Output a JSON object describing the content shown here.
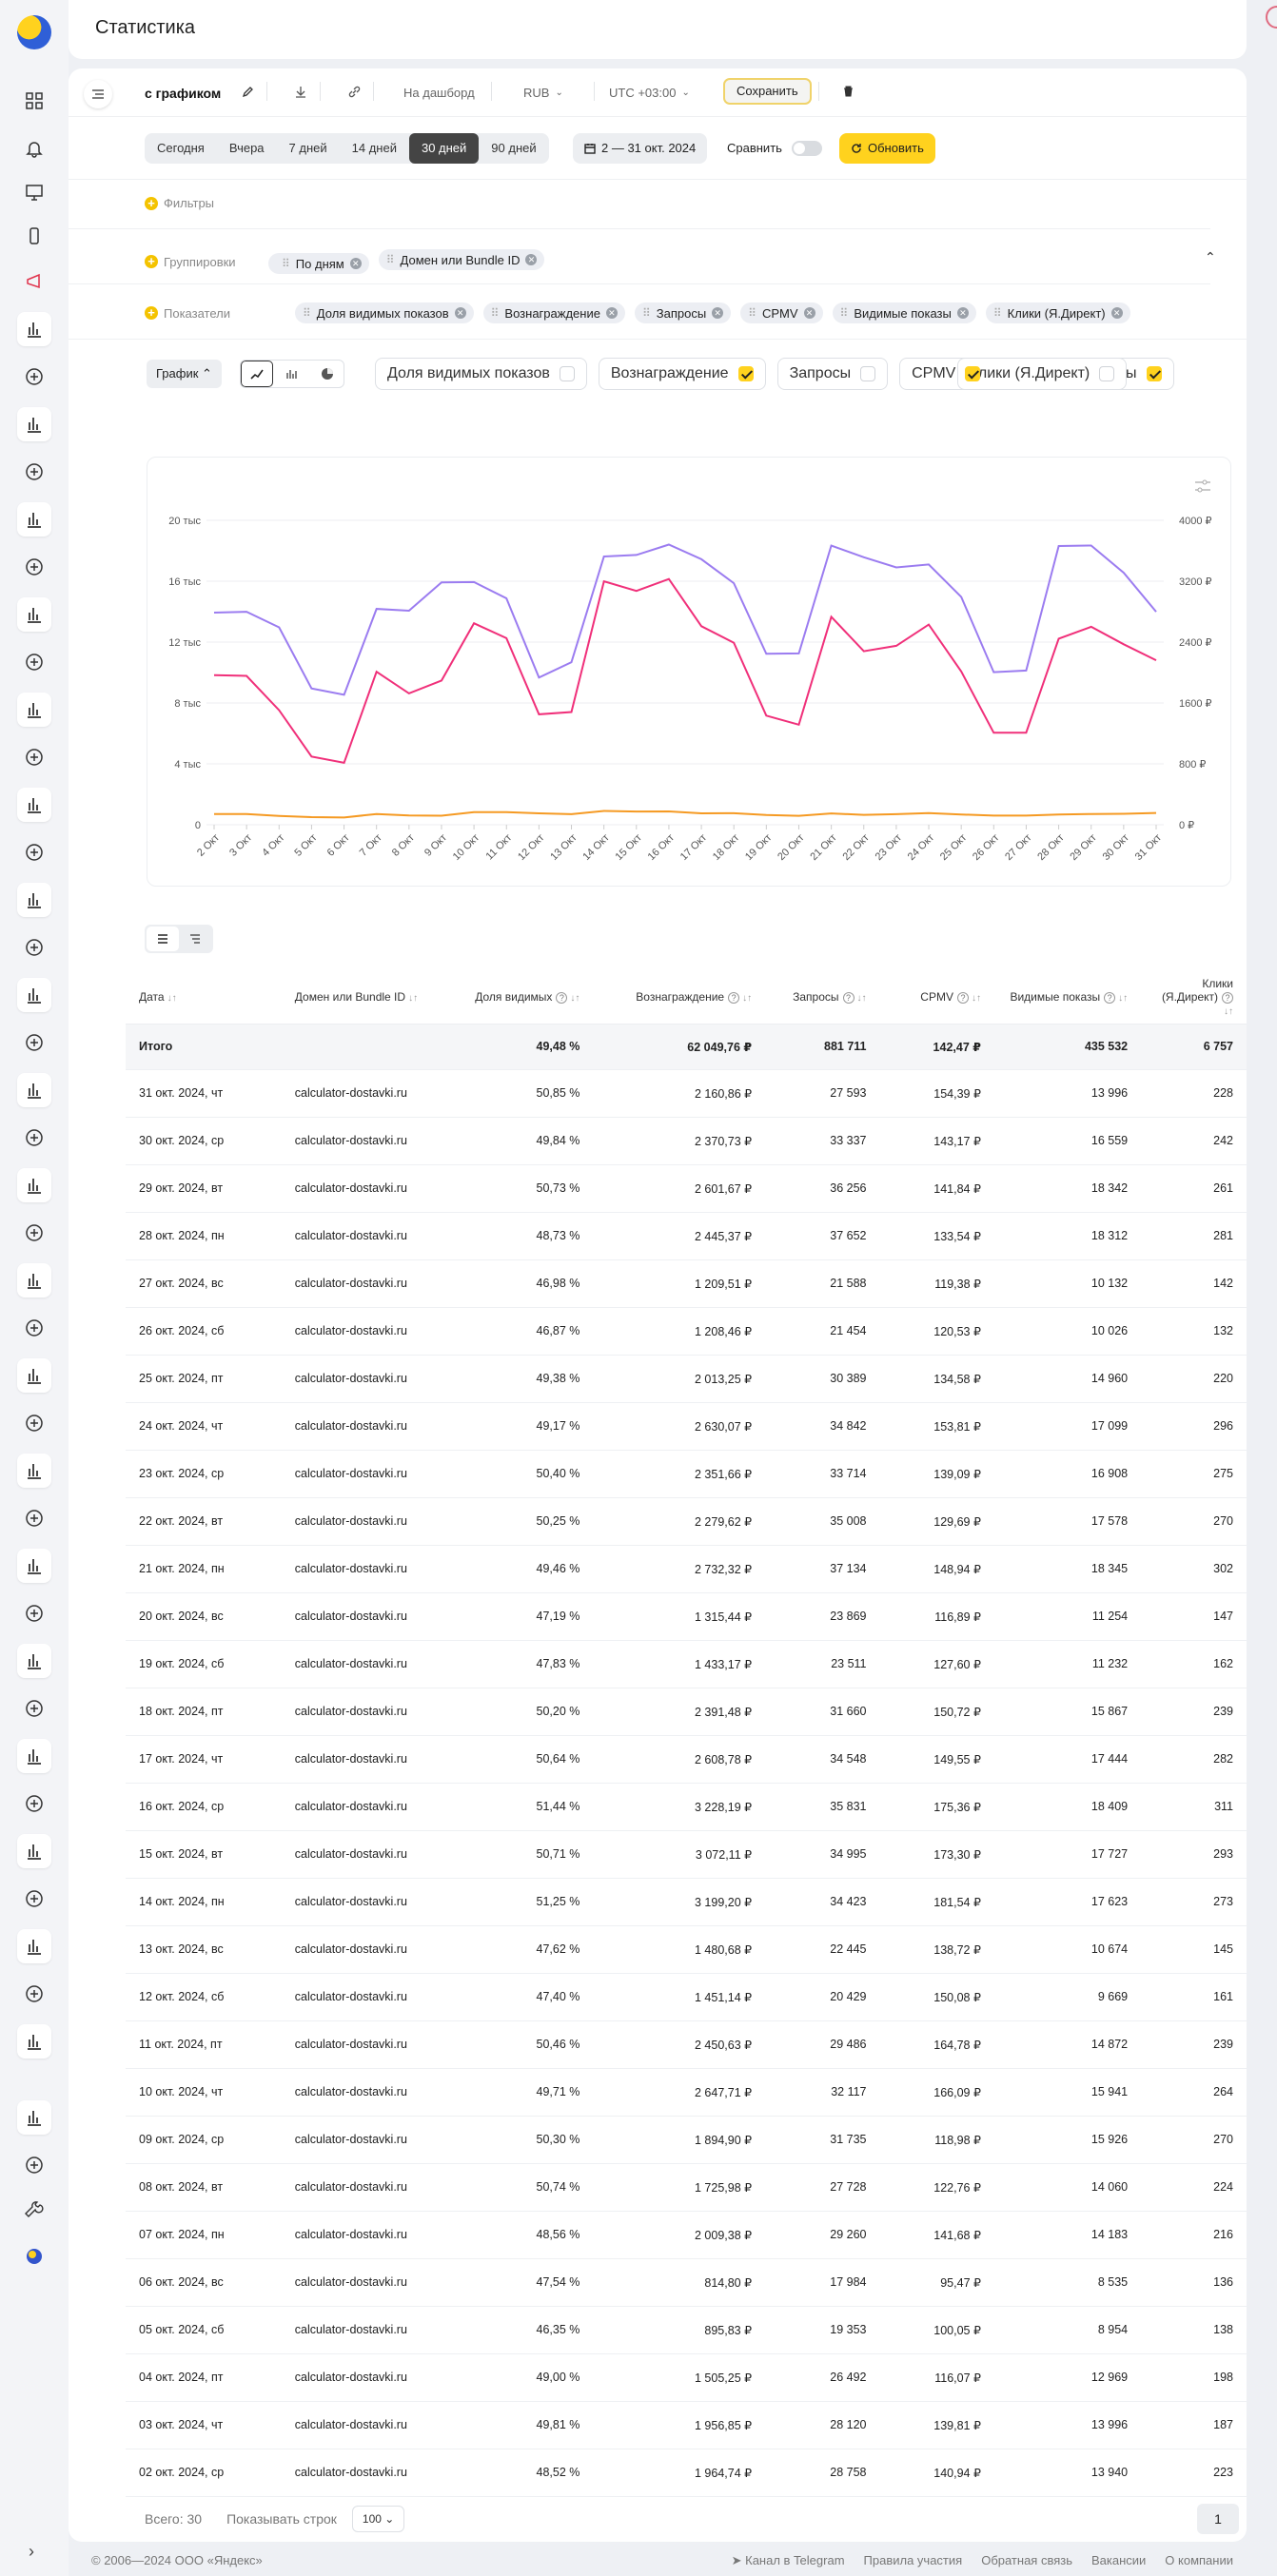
{
  "header": {
    "title": "Статистика"
  },
  "toolbar": {
    "report_name": "с графиком",
    "to_dashboard": "На дашборд",
    "currency": "RUB",
    "timezone": "UTC +03:00",
    "save": "Сохранить"
  },
  "periods": [
    "Сегодня",
    "Вчера",
    "7 дней",
    "14 дней",
    "30 дней",
    "90 дней"
  ],
  "active_period": "30 дней",
  "date_range": "2 — 31 окт. 2024",
  "compare": "Сравнить",
  "refresh": "Обновить",
  "filters": {
    "label": "Фильтры"
  },
  "groupings": {
    "label": "Группировки",
    "chips": [
      "По дням",
      "Домен или Bundle ID"
    ]
  },
  "metrics": {
    "label": "Показатели",
    "chips": [
      "Доля видимых показов",
      "Вознаграждение",
      "Запросы",
      "CPMV",
      "Видимые показы",
      "Клики (Я.Директ)"
    ]
  },
  "chart_toggle": {
    "mode": "График",
    "series": [
      {
        "label": "Доля видимых показов",
        "checked": false
      },
      {
        "label": "Вознаграждение",
        "checked": true
      },
      {
        "label": "Запросы",
        "checked": false
      },
      {
        "label": "CPMV",
        "checked": true
      },
      {
        "label": "Видимые показы",
        "checked": true
      },
      {
        "label": "Клики (Я.Директ)",
        "checked": false
      }
    ]
  },
  "chart_data": {
    "type": "line",
    "x": [
      "2 Окт",
      "3 Окт",
      "4 Окт",
      "5 Окт",
      "6 Окт",
      "7 Окт",
      "8 Окт",
      "9 Окт",
      "10 Окт",
      "11 Окт",
      "12 Окт",
      "13 Окт",
      "14 Окт",
      "15 Окт",
      "16 Окт",
      "17 Окт",
      "18 Окт",
      "19 Окт",
      "20 Окт",
      "21 Окт",
      "22 Окт",
      "23 Окт",
      "24 Окт",
      "25 Окт",
      "26 Окт",
      "27 Окт",
      "28 Окт",
      "29 Окт",
      "30 Окт",
      "31 Окт"
    ],
    "y_left": {
      "ticks": [
        "0",
        "4 тыс",
        "8 тыс",
        "12 тыс",
        "16 тыс",
        "20 тыс"
      ],
      "range": [
        0,
        20000
      ]
    },
    "y_right": {
      "ticks": [
        "0 ₽",
        "800 ₽",
        "1600 ₽",
        "2400 ₽",
        "3200 ₽",
        "4000 ₽"
      ],
      "range": [
        0,
        4000
      ]
    },
    "series": [
      {
        "color": "#9b7cf0",
        "axis": "left",
        "values": [
          13940,
          13996,
          12969,
          8954,
          8535,
          14183,
          14060,
          15926,
          15941,
          14872,
          9669,
          10674,
          17623,
          17727,
          18409,
          17444,
          15867,
          11232,
          11254,
          18345,
          17578,
          16908,
          17099,
          14960,
          10026,
          10132,
          18312,
          18342,
          16559,
          13996
        ]
      },
      {
        "color": "#f0307a",
        "axis": "right",
        "values": [
          1964.74,
          1956.85,
          1505.25,
          895.83,
          814.8,
          2009.38,
          1725.98,
          1894.9,
          2647.71,
          2450.63,
          1451.14,
          1480.68,
          3199.2,
          3072.11,
          3228.19,
          2608.78,
          2391.48,
          1433.17,
          1315.44,
          2732.32,
          2279.62,
          2351.66,
          2630.07,
          2013.25,
          1208.46,
          1209.51,
          2445.37,
          2601.67,
          2370.73,
          2160.86
        ]
      },
      {
        "color": "#f59a23",
        "axis": "right",
        "values": [
          140.94,
          139.81,
          116.07,
          100.05,
          95.47,
          141.68,
          122.76,
          118.98,
          166.09,
          164.78,
          150.08,
          138.72,
          181.54,
          173.3,
          175.36,
          149.55,
          150.72,
          127.6,
          116.89,
          148.94,
          129.69,
          139.09,
          153.81,
          134.58,
          120.53,
          119.38,
          133.54,
          141.84,
          143.17,
          154.39
        ]
      }
    ]
  },
  "table": {
    "headers": [
      "Дата",
      "Домен или Bundle ID",
      "Доля видимых",
      "Вознаграждение",
      "Запросы",
      "CPMV",
      "Видимые показы",
      "Клики (Я.Директ)"
    ],
    "total": [
      "Итого",
      "",
      "49,48 %",
      "62 049,76 ₽",
      "881 711",
      "142,47 ₽",
      "435 532",
      "6 757"
    ],
    "rows": [
      [
        "31 окт. 2024, чт",
        "calculator-dostavki.ru",
        "50,85 %",
        "2 160,86 ₽",
        "27 593",
        "154,39 ₽",
        "13 996",
        "228"
      ],
      [
        "30 окт. 2024, ср",
        "calculator-dostavki.ru",
        "49,84 %",
        "2 370,73 ₽",
        "33 337",
        "143,17 ₽",
        "16 559",
        "242"
      ],
      [
        "29 окт. 2024, вт",
        "calculator-dostavki.ru",
        "50,73 %",
        "2 601,67 ₽",
        "36 256",
        "141,84 ₽",
        "18 342",
        "261"
      ],
      [
        "28 окт. 2024, пн",
        "calculator-dostavki.ru",
        "48,73 %",
        "2 445,37 ₽",
        "37 652",
        "133,54 ₽",
        "18 312",
        "281"
      ],
      [
        "27 окт. 2024, вс",
        "calculator-dostavki.ru",
        "46,98 %",
        "1 209,51 ₽",
        "21 588",
        "119,38 ₽",
        "10 132",
        "142"
      ],
      [
        "26 окт. 2024, сб",
        "calculator-dostavki.ru",
        "46,87 %",
        "1 208,46 ₽",
        "21 454",
        "120,53 ₽",
        "10 026",
        "132"
      ],
      [
        "25 окт. 2024, пт",
        "calculator-dostavki.ru",
        "49,38 %",
        "2 013,25 ₽",
        "30 389",
        "134,58 ₽",
        "14 960",
        "220"
      ],
      [
        "24 окт. 2024, чт",
        "calculator-dostavki.ru",
        "49,17 %",
        "2 630,07 ₽",
        "34 842",
        "153,81 ₽",
        "17 099",
        "296"
      ],
      [
        "23 окт. 2024, ср",
        "calculator-dostavki.ru",
        "50,40 %",
        "2 351,66 ₽",
        "33 714",
        "139,09 ₽",
        "16 908",
        "275"
      ],
      [
        "22 окт. 2024, вт",
        "calculator-dostavki.ru",
        "50,25 %",
        "2 279,62 ₽",
        "35 008",
        "129,69 ₽",
        "17 578",
        "270"
      ],
      [
        "21 окт. 2024, пн",
        "calculator-dostavki.ru",
        "49,46 %",
        "2 732,32 ₽",
        "37 134",
        "148,94 ₽",
        "18 345",
        "302"
      ],
      [
        "20 окт. 2024, вс",
        "calculator-dostavki.ru",
        "47,19 %",
        "1 315,44 ₽",
        "23 869",
        "116,89 ₽",
        "11 254",
        "147"
      ],
      [
        "19 окт. 2024, сб",
        "calculator-dostavki.ru",
        "47,83 %",
        "1 433,17 ₽",
        "23 511",
        "127,60 ₽",
        "11 232",
        "162"
      ],
      [
        "18 окт. 2024, пт",
        "calculator-dostavki.ru",
        "50,20 %",
        "2 391,48 ₽",
        "31 660",
        "150,72 ₽",
        "15 867",
        "239"
      ],
      [
        "17 окт. 2024, чт",
        "calculator-dostavki.ru",
        "50,64 %",
        "2 608,78 ₽",
        "34 548",
        "149,55 ₽",
        "17 444",
        "282"
      ],
      [
        "16 окт. 2024, ср",
        "calculator-dostavki.ru",
        "51,44 %",
        "3 228,19 ₽",
        "35 831",
        "175,36 ₽",
        "18 409",
        "311"
      ],
      [
        "15 окт. 2024, вт",
        "calculator-dostavki.ru",
        "50,71 %",
        "3 072,11 ₽",
        "34 995",
        "173,30 ₽",
        "17 727",
        "293"
      ],
      [
        "14 окт. 2024, пн",
        "calculator-dostavki.ru",
        "51,25 %",
        "3 199,20 ₽",
        "34 423",
        "181,54 ₽",
        "17 623",
        "273"
      ],
      [
        "13 окт. 2024, вс",
        "calculator-dostavki.ru",
        "47,62 %",
        "1 480,68 ₽",
        "22 445",
        "138,72 ₽",
        "10 674",
        "145"
      ],
      [
        "12 окт. 2024, сб",
        "calculator-dostavki.ru",
        "47,40 %",
        "1 451,14 ₽",
        "20 429",
        "150,08 ₽",
        "9 669",
        "161"
      ],
      [
        "11 окт. 2024, пт",
        "calculator-dostavki.ru",
        "50,46 %",
        "2 450,63 ₽",
        "29 486",
        "164,78 ₽",
        "14 872",
        "239"
      ],
      [
        "10 окт. 2024, чт",
        "calculator-dostavki.ru",
        "49,71 %",
        "2 647,71 ₽",
        "32 117",
        "166,09 ₽",
        "15 941",
        "264"
      ],
      [
        "09 окт. 2024, ср",
        "calculator-dostavki.ru",
        "50,30 %",
        "1 894,90 ₽",
        "31 735",
        "118,98 ₽",
        "15 926",
        "270"
      ],
      [
        "08 окт. 2024, вт",
        "calculator-dostavki.ru",
        "50,74 %",
        "1 725,98 ₽",
        "27 728",
        "122,76 ₽",
        "14 060",
        "224"
      ],
      [
        "07 окт. 2024, пн",
        "calculator-dostavki.ru",
        "48,56 %",
        "2 009,38 ₽",
        "29 260",
        "141,68 ₽",
        "14 183",
        "216"
      ],
      [
        "06 окт. 2024, вс",
        "calculator-dostavki.ru",
        "47,54 %",
        "814,80 ₽",
        "17 984",
        "95,47 ₽",
        "8 535",
        "136"
      ],
      [
        "05 окт. 2024, сб",
        "calculator-dostavki.ru",
        "46,35 %",
        "895,83 ₽",
        "19 353",
        "100,05 ₽",
        "8 954",
        "138"
      ],
      [
        "04 окт. 2024, пт",
        "calculator-dostavki.ru",
        "49,00 %",
        "1 505,25 ₽",
        "26 492",
        "116,07 ₽",
        "12 969",
        "198"
      ],
      [
        "03 окт. 2024, чт",
        "calculator-dostavki.ru",
        "49,81 %",
        "1 956,85 ₽",
        "28 120",
        "139,81 ₽",
        "13 996",
        "187"
      ],
      [
        "02 окт. 2024, ср",
        "calculator-dostavki.ru",
        "48,52 %",
        "1 964,74 ₽",
        "28 758",
        "140,94 ₽",
        "13 940",
        "223"
      ]
    ]
  },
  "pagination": {
    "total": "Всего: 30",
    "show_rows": "Показывать строк",
    "rows_per_page": "100",
    "page": "1"
  },
  "footer": {
    "copyright": "© 2006—2024 ООО «Яндекс»",
    "links": [
      "Канал в Telegram",
      "Правила участия",
      "Обратная связь",
      "Вакансии",
      "О компании"
    ]
  }
}
